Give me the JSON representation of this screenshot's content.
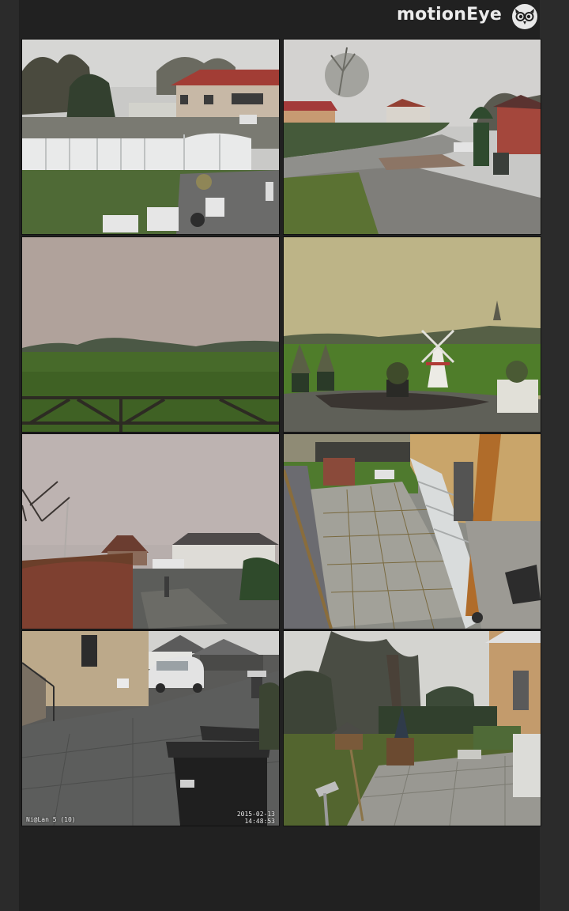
{
  "app": {
    "title": "motionEye",
    "logo_icon": "owl-icon",
    "colors": {
      "frame": "#2b2b2b",
      "panel": "#212121",
      "text": "#ececec"
    }
  },
  "cameras": [
    {
      "scene": "house-with-white-fence-yard"
    },
    {
      "scene": "rural-road-with-houses"
    },
    {
      "scene": "foggy-field-with-railing"
    },
    {
      "scene": "field-with-windmill-ornament"
    },
    {
      "scene": "street-view-with-hedge"
    },
    {
      "scene": "tiled-patio-with-bench"
    },
    {
      "scene": "driveway-with-wheelie-bins",
      "osd_left": "Ni@Lan 5 (10)",
      "osd_date": "2015-02-13",
      "osd_time": "14:48:53"
    },
    {
      "scene": "garden-patio-with-birdhouse"
    }
  ]
}
